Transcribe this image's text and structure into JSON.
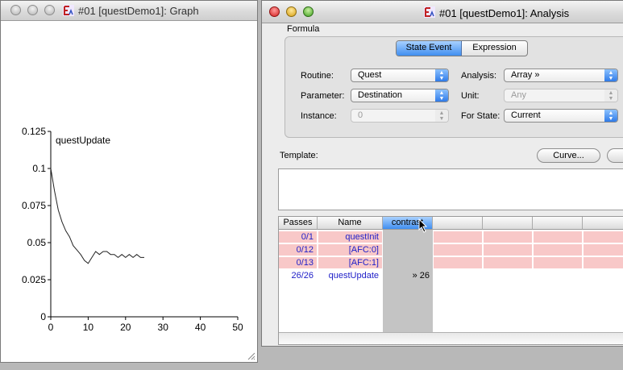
{
  "graph_window": {
    "title": "#01 [questDemo1]: Graph",
    "chart_data": {
      "type": "line",
      "title": "questUpdate",
      "xlabel": "",
      "ylabel": "",
      "xlim": [
        0,
        50
      ],
      "ylim": [
        0,
        0.125
      ],
      "xticks": [
        "0",
        "10",
        "20",
        "30",
        "40",
        "50"
      ],
      "yticks": [
        "0",
        "0.025",
        "0.05",
        "0.075",
        "0.1",
        "0.125"
      ],
      "series": [
        {
          "name": "questUpdate",
          "x": [
            0,
            1,
            2,
            3,
            4,
            5,
            6,
            7,
            8,
            9,
            10,
            11,
            12,
            13,
            14,
            15,
            16,
            17,
            18,
            19,
            20,
            21,
            22,
            23,
            24,
            25
          ],
          "y": [
            0.1,
            0.085,
            0.072,
            0.064,
            0.058,
            0.054,
            0.048,
            0.045,
            0.042,
            0.038,
            0.036,
            0.04,
            0.044,
            0.042,
            0.044,
            0.044,
            0.042,
            0.042,
            0.04,
            0.042,
            0.04,
            0.042,
            0.04,
            0.042,
            0.04,
            0.04
          ]
        }
      ]
    }
  },
  "analysis_window": {
    "title": "#01 [questDemo1]: Analysis",
    "formula_label": "Formula",
    "tabs": [
      "State Event",
      "Expression"
    ],
    "fields": {
      "routine_label": "Routine:",
      "routine_value": "Quest",
      "parameter_label": "Parameter:",
      "parameter_value": "Destination",
      "instance_label": "Instance:",
      "instance_value": "0",
      "analysis_label": "Analysis:",
      "analysis_value": "Array »",
      "unit_label": "Unit:",
      "unit_value": "Any",
      "forstate_label": "For State:",
      "forstate_value": "Current"
    },
    "template_label": "Template:",
    "curve_button": "Curve...",
    "table": {
      "headers": [
        "Passes",
        "Name",
        "contrast"
      ],
      "rows": [
        {
          "passes": "0/1",
          "name": "questInit",
          "value": ""
        },
        {
          "passes": "0/12",
          "name": "[AFC:0]",
          "value": ""
        },
        {
          "passes": "0/13",
          "name": "[AFC:1]",
          "value": ""
        },
        {
          "passes": "26/26",
          "name": "questUpdate",
          "value": "» 26"
        }
      ]
    }
  },
  "colors": {
    "accent": "#3a7ee8",
    "pink_row": "#f8c8c8",
    "link_text": "#2020c8"
  }
}
